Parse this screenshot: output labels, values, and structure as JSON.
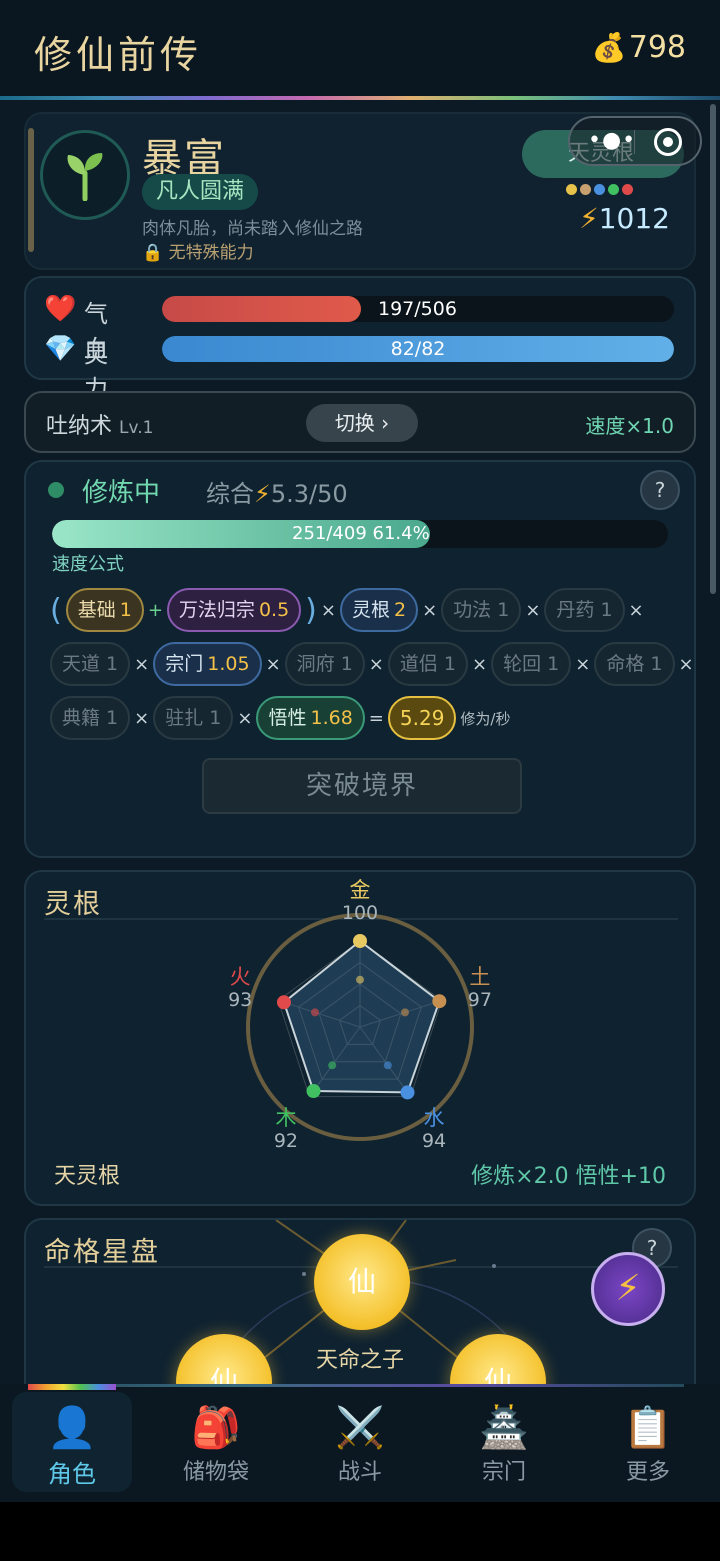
{
  "app": {
    "title": "修仙前传",
    "gold": "798",
    "gold_icon": "money-bag-icon"
  },
  "profile": {
    "name": "暴富",
    "realm": "凡人圆满",
    "desc": "肉体凡胎，尚未踏入修仙之路",
    "ability": "无特殊能力",
    "root_label": "天灵根",
    "root_colors": [
      "#e6c24a",
      "#c8a070",
      "#4a90e0",
      "#40c060",
      "#e04a4a"
    ],
    "power": "1012"
  },
  "vitals": {
    "hp_label": "气血",
    "hp_text": "197/506",
    "hp_value": 197,
    "hp_max": 506,
    "mp_label": "灵力",
    "mp_text": "82/82",
    "mp_value": 82,
    "mp_max": 82
  },
  "technique": {
    "name": "吐纳术",
    "level": "Lv.1",
    "switch_label": "切换 ›",
    "speed": "速度×1.0"
  },
  "cultivation": {
    "status": "修炼中",
    "total_label": "综合",
    "total_value": "5.3/50",
    "help": "?",
    "progress_text": "251/409  61.4%",
    "progress_fraction": 0.614,
    "formula_label": "速度公式",
    "chips": {
      "base": "基础",
      "base_v": "1",
      "wanfa": "万法归宗",
      "wanfa_v": "0.5",
      "root": "灵根",
      "root_v": "2",
      "gongfa": "功法 1",
      "danyao": "丹药 1",
      "tiandao": "天道 1",
      "zongmen": "宗门",
      "zongmen_v": "1.05",
      "dongfu": "洞府 1",
      "daolv": "道侣 1",
      "lunhui": "轮回 1",
      "mingge": "命格 1",
      "dianji": "典籍 1",
      "zhuzha": "驻扎 1",
      "wuxing": "悟性",
      "wuxing_v": "1.68",
      "result": "5.29",
      "unit": "修为/秒"
    },
    "breakthrough": "突破境界"
  },
  "roots": {
    "title": "灵根",
    "elements": [
      {
        "name": "金",
        "value": 100,
        "color": "#e8c860"
      },
      {
        "name": "土",
        "value": 97,
        "color": "#c89050"
      },
      {
        "name": "水",
        "value": 94,
        "color": "#4a90e0"
      },
      {
        "name": "木",
        "value": 92,
        "color": "#40c060"
      },
      {
        "name": "火",
        "value": 93,
        "color": "#e04a4a"
      }
    ],
    "root_name": "天灵根",
    "bonus": "修炼×2.0  悟性+10"
  },
  "star_plate": {
    "title": "命格星盘",
    "help": "?",
    "orb_char": "仙",
    "center_label": "天命之子"
  },
  "tabs": [
    {
      "label": "角色",
      "icon": "person-icon"
    },
    {
      "label": "储物袋",
      "icon": "backpack-icon"
    },
    {
      "label": "战斗",
      "icon": "crossed-swords-icon"
    },
    {
      "label": "宗门",
      "icon": "pagoda-icon"
    },
    {
      "label": "更多",
      "icon": "clipboard-icon"
    }
  ]
}
